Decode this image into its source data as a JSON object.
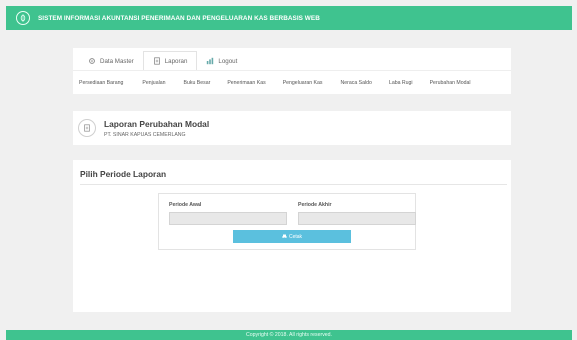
{
  "app": {
    "title": "SISTEM INFORMASI AKUNTANSI PENERIMAAN DAN PENGELUARAN KAS BERBASIS WEB",
    "logo_icon": "leaf-logo-icon",
    "accent_color": "#3fc38f"
  },
  "tabs": [
    {
      "label": "Data Master",
      "icon": "gear-icon",
      "active": false
    },
    {
      "label": "Laporan",
      "icon": "document-icon",
      "active": true
    },
    {
      "label": "Logout",
      "icon": "chart-icon",
      "active": false
    }
  ],
  "submenu": [
    "Persediaan Barang",
    "Penjualan",
    "Buku Besar",
    "Penerimaan Kas",
    "Pengeluaran Kas",
    "Neraca Saldo",
    "Laba Rugi",
    "Perubahan Modal"
  ],
  "header": {
    "title": "Laporan Perubahan Modal",
    "subtitle": "PT. SINAR KAPUAS CEMERLANG",
    "icon": "document-icon"
  },
  "section": {
    "title": "Pilih Periode Laporan"
  },
  "form": {
    "start_label": "Periode Awal",
    "end_label": "Periode Akhir",
    "start_value": "",
    "end_value": "",
    "print_label": "Cetak",
    "print_icon": "printer-icon",
    "button_color": "#5bc0de"
  },
  "footer": {
    "text": "Copyright © 2018. All rights reserved."
  }
}
